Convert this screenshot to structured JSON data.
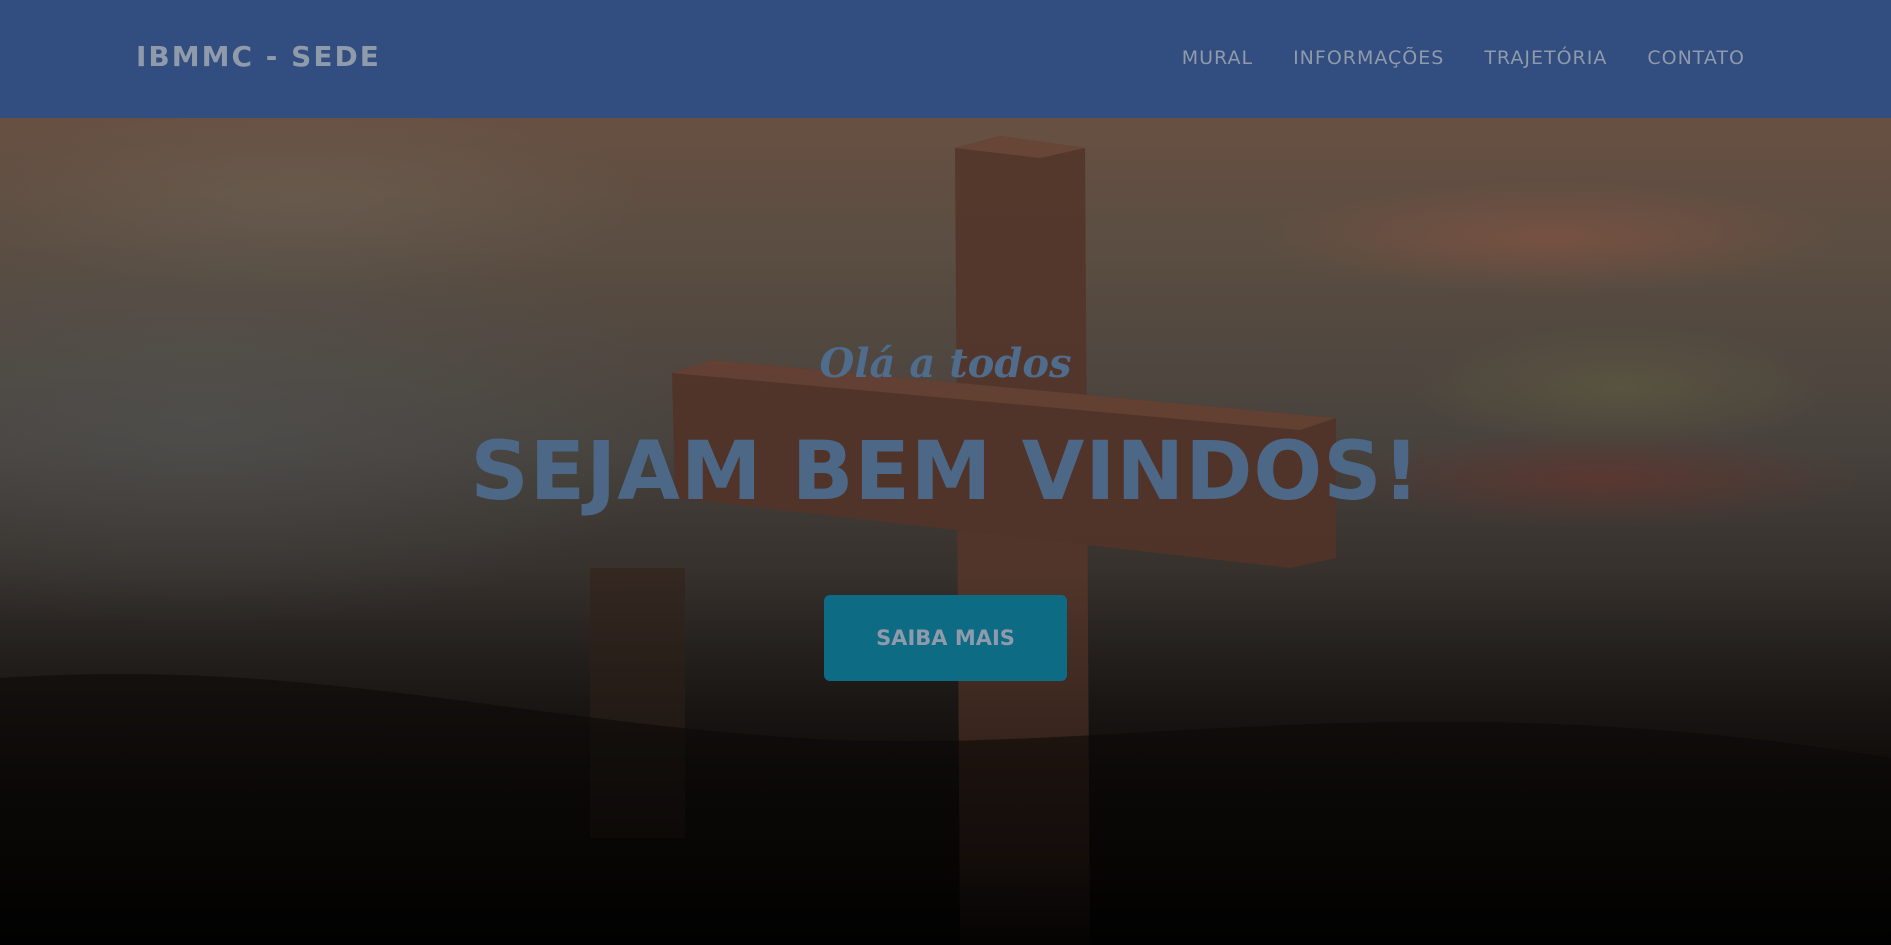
{
  "navbar": {
    "brand": "IBMMC - SEDE",
    "links": [
      {
        "label": "MURAL"
      },
      {
        "label": "INFORMAÇÕES"
      },
      {
        "label": "TRAJETÓRIA"
      },
      {
        "label": "CONTATO"
      }
    ]
  },
  "hero": {
    "subtitle": "Olá a todos",
    "headline": "SEJAM BEM VINDOS!",
    "cta_label": "SAIBA MAIS"
  },
  "colors": {
    "navbar_bg": "#324d7f",
    "nav_text": "#8f9aab",
    "heading_text": "#4d6887",
    "cta_bg": "#0d6b84"
  }
}
